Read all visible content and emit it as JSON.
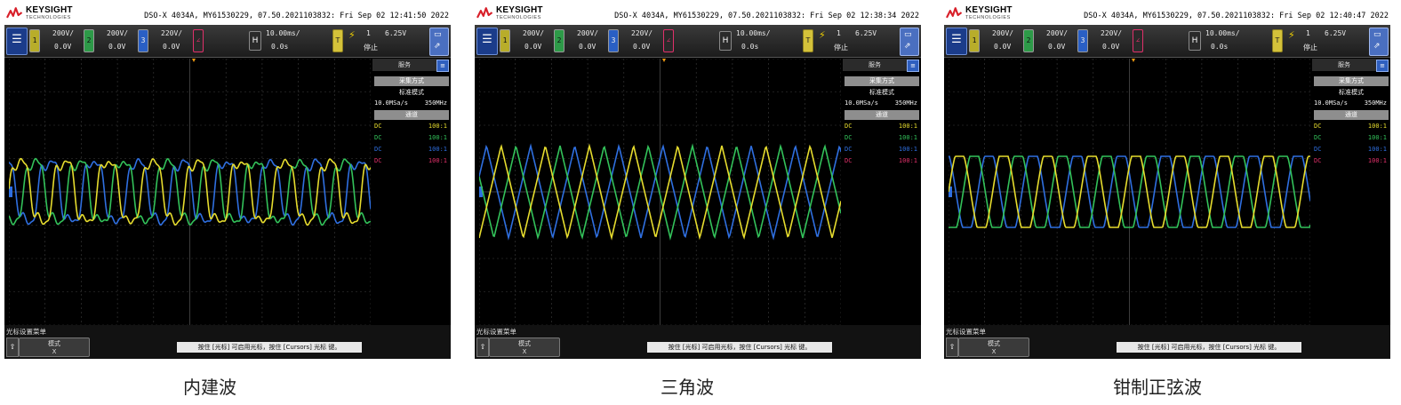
{
  "brand": {
    "name": "KEYSIGHT",
    "sub": "TECHNOLOGIES"
  },
  "colors": {
    "ch1": "#e6dc2e",
    "ch2": "#33c25a",
    "ch3": "#2f6fe0",
    "ch4": "#e0306a",
    "grid": "#3c3c3c"
  },
  "icons": {
    "menu": "menu-icon",
    "up": "arrow-up-icon",
    "display": "display-icon",
    "trigger": "trigger-edge-icon"
  },
  "channels": [
    {
      "label": "1",
      "scale": "200V/",
      "offset": "0.0V"
    },
    {
      "label": "2",
      "scale": "200V/",
      "offset": "0.0V"
    },
    {
      "label": "3",
      "scale": "220V/",
      "offset": "0.0V"
    }
  ],
  "timebase": {
    "label": "H",
    "scale": "10.00ms/",
    "delay": "0.0s"
  },
  "trigger": {
    "source": "1",
    "level": "6.25V",
    "mode": "停止"
  },
  "sidebar": {
    "tab": "服务",
    "acq_header": "采集方式",
    "acq_mode": "标准模式",
    "rate": "10.0MSa/s",
    "rate_right": "350MHz",
    "channels_header": "通道",
    "coupling": [
      "DC",
      "DC",
      "DC",
      "DC"
    ],
    "probe": [
      "100:1",
      "100:1",
      "100:1",
      "100:1"
    ]
  },
  "footer": {
    "title": "光标设置菜单",
    "mode_label": "模式",
    "mode_value": "X",
    "message": "按住 [光标] 可启用光标，按住 [Cursors] 光标 键。"
  },
  "screens": [
    {
      "header": "DSO-X 4034A, MY61530229, 07.50.2021103832: Fri Sep 02 12:41:50 2022",
      "caption": "内建波",
      "waveform": "builtin"
    },
    {
      "header": "DSO-X 4034A, MY61530229, 07.50.2021103832: Fri Sep 02 12:38:34 2022",
      "caption": "三角波",
      "waveform": "triangle"
    },
    {
      "header": "DSO-X 4034A, MY61530229, 07.50.2021103832: Fri Sep 02 12:40:47 2022",
      "caption": "钳制正弦波",
      "waveform": "clamped-sine"
    }
  ]
}
